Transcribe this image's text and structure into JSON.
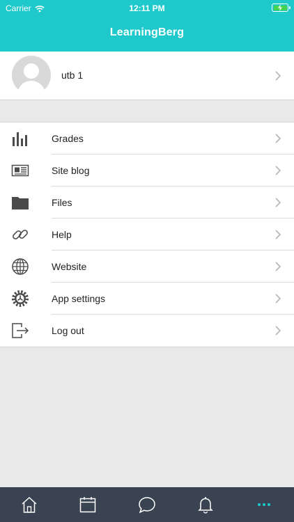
{
  "status": {
    "carrier": "Carrier",
    "time": "12:11 PM",
    "charging_icon": "bolt-icon"
  },
  "header": {
    "title": "LearningBerg",
    "color": "#1ec8cb"
  },
  "profile": {
    "name": "utb 1"
  },
  "menu": [
    {
      "label": "Grades",
      "icon": "bar-chart-icon"
    },
    {
      "label": "Site blog",
      "icon": "newspaper-icon"
    },
    {
      "label": "Files",
      "icon": "folder-icon"
    },
    {
      "label": "Help",
      "icon": "link-icon"
    },
    {
      "label": "Website",
      "icon": "globe-icon"
    },
    {
      "label": "App settings",
      "icon": "gear-icon"
    },
    {
      "label": "Log out",
      "icon": "logout-icon"
    }
  ],
  "tabbar": {
    "background": "#3a4351",
    "items": [
      "home-icon",
      "calendar-icon",
      "messages-icon",
      "notifications-icon",
      "more-icon"
    ],
    "active": "more-icon"
  }
}
